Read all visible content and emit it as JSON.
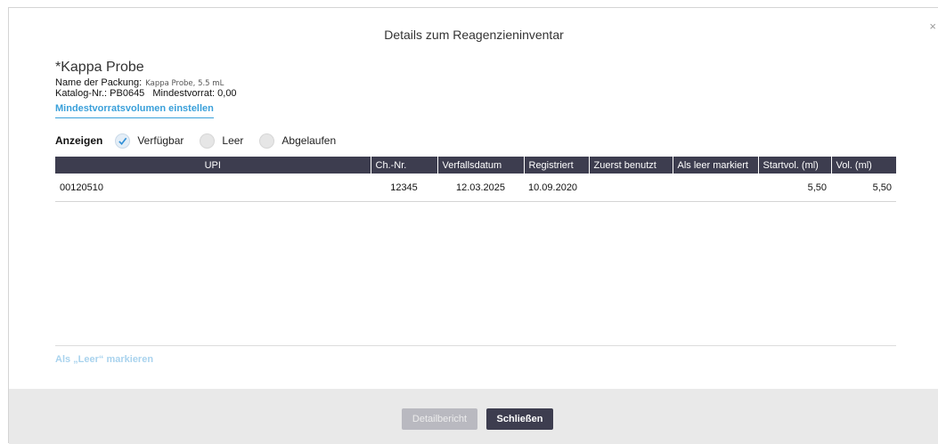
{
  "dialog": {
    "title": "Details zum Reagenzieninventar",
    "close_glyph": "×"
  },
  "product": {
    "name": "*Kappa Probe",
    "pack_label": "Name der Packung:",
    "pack_value": "Kappa Probe, 5.5 mL",
    "catalog_label": "Katalog-Nr.:",
    "catalog_value": "PB0645",
    "min_stock_label": "Mindestvorrat:",
    "min_stock_value": "0,00",
    "set_min_link": "Mindestvorratsvolumen einstellen"
  },
  "filter": {
    "label": "Anzeigen",
    "options": [
      {
        "label": "Verfügbar",
        "checked": true,
        "icon": "checkmark-icon"
      },
      {
        "label": "Leer",
        "checked": false
      },
      {
        "label": "Abgelaufen",
        "checked": false
      }
    ]
  },
  "table": {
    "columns": [
      "UPI",
      "Ch.-Nr.",
      "Verfallsdatum",
      "Registriert",
      "Zuerst benutzt",
      "Als leer markiert",
      "Startvol. (ml)",
      "Vol. (ml)"
    ],
    "rows": [
      {
        "upi": "00120510",
        "lot": "12345",
        "expiry": "12.03.2025",
        "registered": "10.09.2020",
        "first_used": "",
        "marked_empty": "",
        "start_vol": "5,50",
        "vol": "5,50"
      }
    ]
  },
  "actions": {
    "mark_empty": "Als „Leer“ markieren",
    "detail_report": "Detailbericht",
    "close": "Schließen"
  },
  "colors": {
    "header_bg": "#3d3d4f",
    "link_blue": "#3aa0da",
    "disabled_link": "#a9d3ee",
    "footer_bg": "#e9e9e9"
  }
}
